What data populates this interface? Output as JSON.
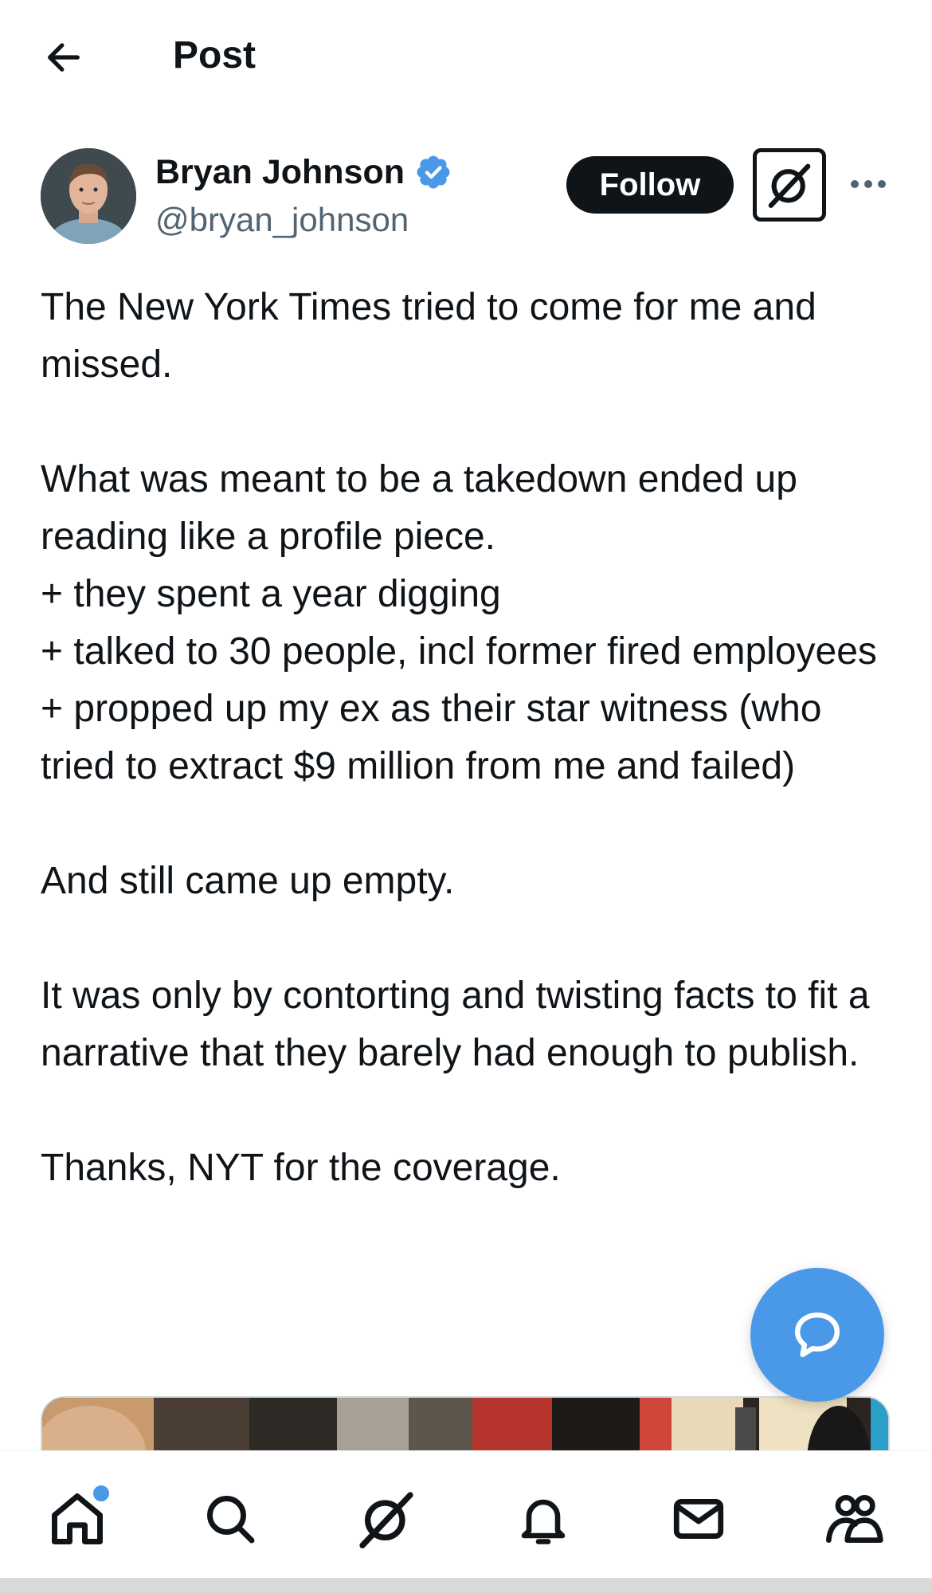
{
  "header": {
    "title": "Post",
    "back_icon": "arrow-left-icon"
  },
  "author": {
    "name": "Bryan Johnson",
    "handle": "@bryan_johnson",
    "verified": true,
    "verified_color": "#4a99e9"
  },
  "actions": {
    "follow_label": "Follow",
    "grok_icon": "grok-icon",
    "more_icon": "more-dots-icon"
  },
  "post": {
    "paragraphs": [
      [
        "The New York Times tried to come for me and missed."
      ],
      [
        "What was meant to be a takedown ended up reading like a profile piece.",
        "+ they spent a year digging",
        "+ talked to 30 people, incl former fired employees",
        "+ propped up my ex as their star witness (who tried to extract $9 million from me and failed)"
      ],
      [
        "And still came up empty."
      ],
      [
        "It was only by contorting and twisting facts to fit a narrative that they barely had enough to publish."
      ],
      [
        "Thanks, NYT for the coverage."
      ]
    ]
  },
  "fab": {
    "icon": "reply-bubble-icon",
    "color": "#4a99e9"
  },
  "bottom_nav": {
    "items": [
      {
        "icon": "home-icon",
        "has_notification_dot": true
      },
      {
        "icon": "search-icon"
      },
      {
        "icon": "grok-icon"
      },
      {
        "icon": "bell-icon"
      },
      {
        "icon": "mail-icon"
      },
      {
        "icon": "communities-icon"
      }
    ]
  },
  "colors": {
    "text": "#0f1419",
    "secondary_text": "#536471",
    "accent": "#4a99e9"
  }
}
